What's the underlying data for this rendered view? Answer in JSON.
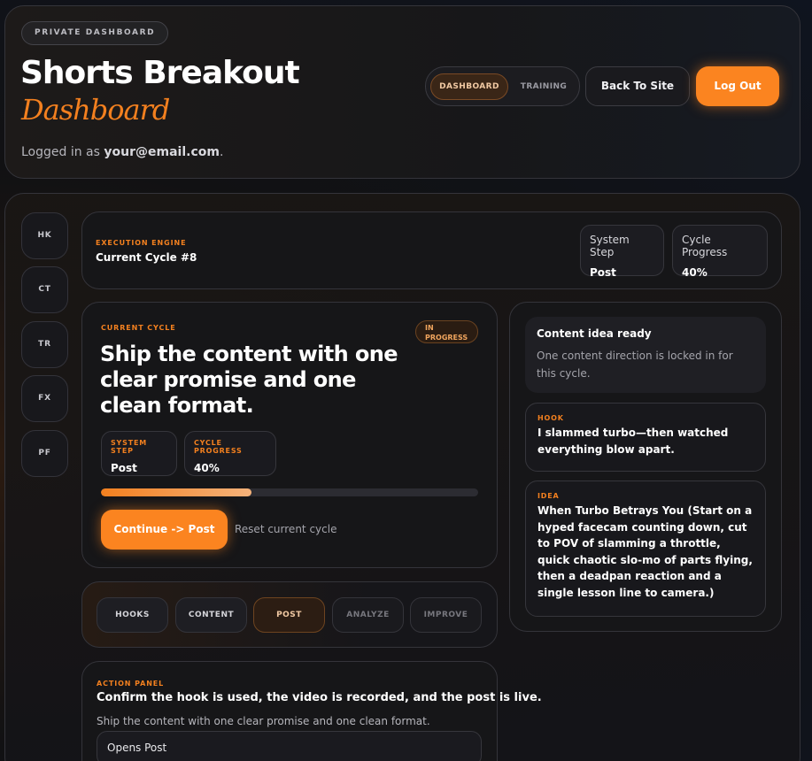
{
  "header": {
    "badge": "PRIVATE DASHBOARD",
    "title": "Shorts Breakout",
    "subtitle": "Dashboard",
    "logged_prefix": "Logged in as",
    "email": "your@email.com",
    "logged_suffix": ".",
    "tabs": [
      {
        "label": "DASHBOARD",
        "active": true
      },
      {
        "label": "TRAINING",
        "active": false
      }
    ],
    "back_label": "Back To Site",
    "logout_label": "Log Out"
  },
  "sidebar": {
    "items": [
      {
        "label": "HK"
      },
      {
        "label": "CT"
      },
      {
        "label": "TR"
      },
      {
        "label": "FX"
      },
      {
        "label": "PF"
      }
    ]
  },
  "engine": {
    "label": "EXECUTION ENGINE",
    "cycle": "Current Cycle #8",
    "step_key": "System Step",
    "step_value": "Post",
    "progress_key": "Cycle Progress",
    "progress_value": "40%"
  },
  "cycle": {
    "label": "CURRENT CYCLE",
    "status": "IN PROGRESS",
    "title": "Ship the content with one clear promise and one clean format.",
    "step_key": "SYSTEM STEP",
    "step_value": "Post",
    "progress_key": "CYCLE PROGRESS",
    "progress_value": "40%",
    "progress_fraction": 0.4,
    "continue_label": "Continue -> Post",
    "reset_label": "Reset current cycle"
  },
  "side": {
    "ready_title": "Content idea ready",
    "ready_desc": "One content direction is locked in for this cycle.",
    "hook_label": "HOOK",
    "hook_text": "I slammed turbo—then watched everything blow apart.",
    "idea_label": "IDEA",
    "idea_text": "When Turbo Betrays You (Start on a hyped facecam counting down, cut to POV of slamming a throttle, quick chaotic slo-mo of parts flying, then a deadpan reaction and a single lesson line to camera.)"
  },
  "steps": [
    {
      "label": "HOOKS",
      "state": "done"
    },
    {
      "label": "CONTENT",
      "state": "done"
    },
    {
      "label": "POST",
      "state": "active"
    },
    {
      "label": "ANALYZE",
      "state": "pending"
    },
    {
      "label": "IMPROVE",
      "state": "pending"
    }
  ],
  "action": {
    "label": "ACTION PANEL",
    "title": "Confirm the hook is used, the video is recorded, and the post is live.",
    "desc": "Ship the content with one clear promise and one clean format.",
    "opens": "Opens Post"
  },
  "colors": {
    "accent": "#f3801f",
    "button": "#fb8420",
    "background": "#111113"
  }
}
